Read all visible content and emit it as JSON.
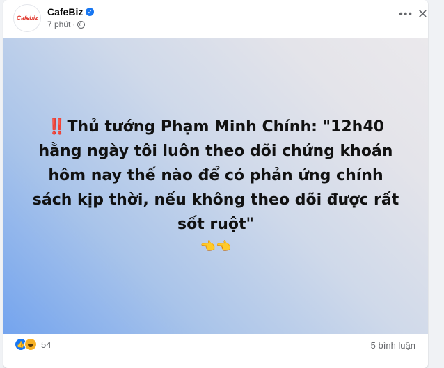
{
  "post": {
    "page_name": "CafeBiz",
    "avatar_text": "Cafebiz",
    "timestamp": "7 phút",
    "separator": "·",
    "text_prefix": "‼️",
    "text": "Thủ tướng Phạm Minh Chính: \"12h40 hằng ngày tôi luôn theo dõi chứng khoán hôm nay thế nào để có phản ứng chính sách kịp thời, nếu không theo dõi được rất sốt ruột\"",
    "text_suffix": "👈👈",
    "reactions_count": "54",
    "comments_label": "5 bình luận"
  },
  "icons": {
    "more": "more-horizontal-icon",
    "close": "close-icon",
    "audience": "globe-icon",
    "verified": "verified-badge-icon",
    "reactions": [
      "like-reaction-icon",
      "haha-reaction-icon"
    ]
  },
  "colors": {
    "brand": "#1877f2",
    "gradient_start": "#74a4ee",
    "gradient_end": "#ebe9ec",
    "muted_text": "#65676b"
  }
}
